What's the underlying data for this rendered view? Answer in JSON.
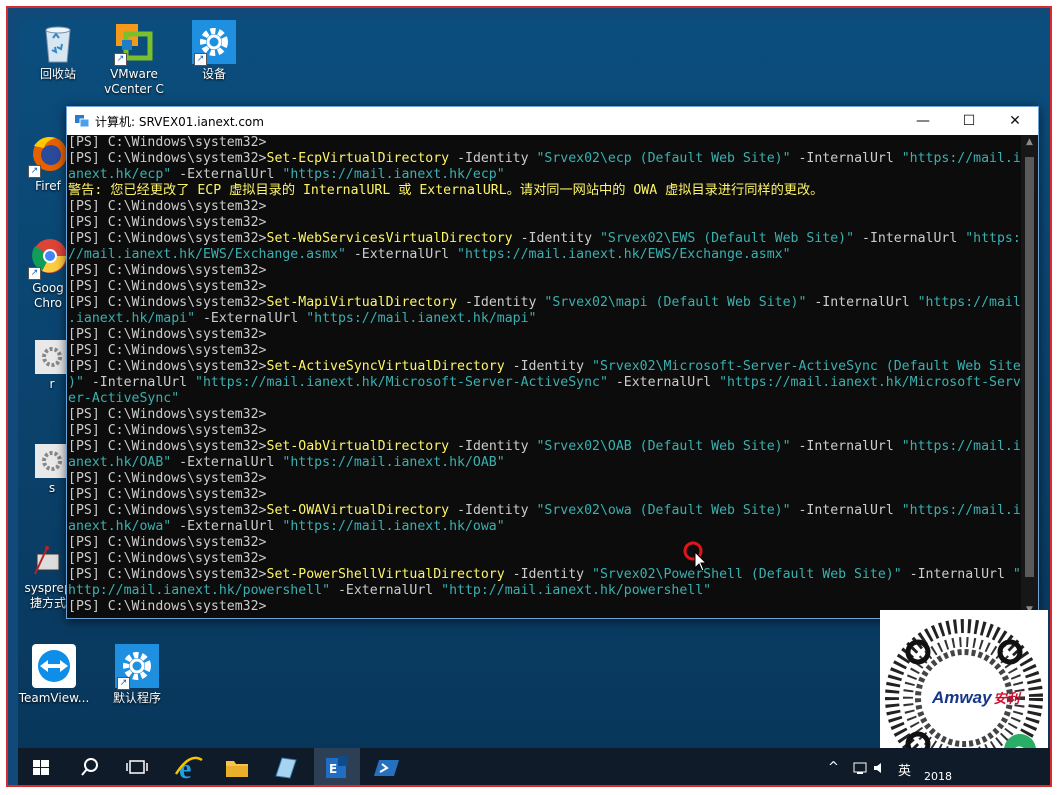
{
  "desktop": {
    "icons": [
      {
        "label": "回收站",
        "icon": "recycle-bin-icon"
      },
      {
        "label": "VMware\nvCenter C",
        "icon": "vmware-icon"
      },
      {
        "label": "设备",
        "icon": "gear-icon"
      },
      {
        "label": "Firef",
        "icon": "firefox-icon"
      },
      {
        "label": "Goog\nChro",
        "icon": "chrome-icon"
      },
      {
        "label": "r",
        "icon": "settings-shortcut-icon"
      },
      {
        "label": "s",
        "icon": "settings-shortcut-icon"
      },
      {
        "label": "sysprep\n捷方式",
        "icon": "sysprep-icon"
      },
      {
        "label": "TeamView...",
        "icon": "teamviewer-icon"
      },
      {
        "label": "默认程序",
        "icon": "gear-icon"
      }
    ]
  },
  "window": {
    "title": "计算机: SRVEX01.ianext.com",
    "minimize": "—",
    "maximize": "☐",
    "close": "✕"
  },
  "console": {
    "lines": [
      [
        {
          "t": "[PS] C:\\Windows\\system32>",
          "c": "par"
        }
      ],
      [
        {
          "t": "[PS] C:\\Windows\\system32>",
          "c": "par"
        },
        {
          "t": "Set-EcpVirtualDirectory",
          "c": "cmd"
        },
        {
          "t": " -Identity ",
          "c": "par"
        },
        {
          "t": "\"Srvex02\\ecp (Default Web Site)\"",
          "c": "str"
        },
        {
          "t": " -InternalUrl ",
          "c": "par"
        },
        {
          "t": "\"https://mail.i",
          "c": "str"
        }
      ],
      [
        {
          "t": "anext.hk/ecp\"",
          "c": "str"
        },
        {
          "t": " -ExternalUrl ",
          "c": "par"
        },
        {
          "t": "\"https://mail.ianext.hk/ecp\"",
          "c": "str"
        }
      ],
      [
        {
          "t": "警告: 您已经更改了 ECP 虚拟目录的 InternalURL 或 ExternalURL。请对同一网站中的 OWA 虚拟目录进行同样的更改。",
          "c": "warn"
        }
      ],
      [
        {
          "t": "[PS] C:\\Windows\\system32>",
          "c": "par"
        }
      ],
      [
        {
          "t": "[PS] C:\\Windows\\system32>",
          "c": "par"
        }
      ],
      [
        {
          "t": "[PS] C:\\Windows\\system32>",
          "c": "par"
        },
        {
          "t": "Set-WebServicesVirtualDirectory",
          "c": "cmd"
        },
        {
          "t": " -Identity ",
          "c": "par"
        },
        {
          "t": "\"Srvex02\\EWS (Default Web Site)\"",
          "c": "str"
        },
        {
          "t": " -InternalUrl ",
          "c": "par"
        },
        {
          "t": "\"https:",
          "c": "str"
        }
      ],
      [
        {
          "t": "//mail.ianext.hk/EWS/Exchange.asmx\"",
          "c": "str"
        },
        {
          "t": " -ExternalUrl ",
          "c": "par"
        },
        {
          "t": "\"https://mail.ianext.hk/EWS/Exchange.asmx\"",
          "c": "str"
        }
      ],
      [
        {
          "t": "[PS] C:\\Windows\\system32>",
          "c": "par"
        }
      ],
      [
        {
          "t": "[PS] C:\\Windows\\system32>",
          "c": "par"
        }
      ],
      [
        {
          "t": "[PS] C:\\Windows\\system32>",
          "c": "par"
        },
        {
          "t": "Set-MapiVirtualDirectory",
          "c": "cmd"
        },
        {
          "t": " -Identity ",
          "c": "par"
        },
        {
          "t": "\"Srvex02\\mapi (Default Web Site)\"",
          "c": "str"
        },
        {
          "t": " -InternalUrl ",
          "c": "par"
        },
        {
          "t": "\"https://mail",
          "c": "str"
        }
      ],
      [
        {
          "t": ".ianext.hk/mapi\"",
          "c": "str"
        },
        {
          "t": " -ExternalUrl ",
          "c": "par"
        },
        {
          "t": "\"https://mail.ianext.hk/mapi\"",
          "c": "str"
        }
      ],
      [
        {
          "t": "[PS] C:\\Windows\\system32>",
          "c": "par"
        }
      ],
      [
        {
          "t": "[PS] C:\\Windows\\system32>",
          "c": "par"
        }
      ],
      [
        {
          "t": "[PS] C:\\Windows\\system32>",
          "c": "par"
        },
        {
          "t": "Set-ActiveSyncVirtualDirectory",
          "c": "cmd"
        },
        {
          "t": " -Identity ",
          "c": "par"
        },
        {
          "t": "\"Srvex02\\Microsoft-Server-ActiveSync (Default Web Site",
          "c": "str"
        }
      ],
      [
        {
          "t": ")\"",
          "c": "str"
        },
        {
          "t": " -InternalUrl ",
          "c": "par"
        },
        {
          "t": "\"https://mail.ianext.hk/Microsoft-Server-ActiveSync\"",
          "c": "str"
        },
        {
          "t": " -ExternalUrl ",
          "c": "par"
        },
        {
          "t": "\"https://mail.ianext.hk/Microsoft-Serv",
          "c": "str"
        }
      ],
      [
        {
          "t": "er-ActiveSync\"",
          "c": "str"
        }
      ],
      [
        {
          "t": "[PS] C:\\Windows\\system32>",
          "c": "par"
        }
      ],
      [
        {
          "t": "[PS] C:\\Windows\\system32>",
          "c": "par"
        }
      ],
      [
        {
          "t": "[PS] C:\\Windows\\system32>",
          "c": "par"
        },
        {
          "t": "Set-OabVirtualDirectory",
          "c": "cmd"
        },
        {
          "t": " -Identity ",
          "c": "par"
        },
        {
          "t": "\"Srvex02\\OAB (Default Web Site)\"",
          "c": "str"
        },
        {
          "t": " -InternalUrl ",
          "c": "par"
        },
        {
          "t": "\"https://mail.i",
          "c": "str"
        }
      ],
      [
        {
          "t": "anext.hk/OAB\"",
          "c": "str"
        },
        {
          "t": " -ExternalUrl ",
          "c": "par"
        },
        {
          "t": "\"https://mail.ianext.hk/OAB\"",
          "c": "str"
        }
      ],
      [
        {
          "t": "[PS] C:\\Windows\\system32>",
          "c": "par"
        }
      ],
      [
        {
          "t": "[PS] C:\\Windows\\system32>",
          "c": "par"
        }
      ],
      [
        {
          "t": "[PS] C:\\Windows\\system32>",
          "c": "par"
        },
        {
          "t": "Set-OWAVirtualDirectory",
          "c": "cmd"
        },
        {
          "t": " -Identity ",
          "c": "par"
        },
        {
          "t": "\"Srvex02\\owa (Default Web Site)\"",
          "c": "str"
        },
        {
          "t": " -InternalUrl ",
          "c": "par"
        },
        {
          "t": "\"https://mail.i",
          "c": "str"
        }
      ],
      [
        {
          "t": "anext.hk/owa\"",
          "c": "str"
        },
        {
          "t": " -ExternalUrl ",
          "c": "par"
        },
        {
          "t": "\"https://mail.ianext.hk/owa\"",
          "c": "str"
        }
      ],
      [
        {
          "t": "[PS] C:\\Windows\\system32>",
          "c": "par"
        }
      ],
      [
        {
          "t": "[PS] C:\\Windows\\system32>",
          "c": "par"
        }
      ],
      [
        {
          "t": "[PS] C:\\Windows\\system32>",
          "c": "par"
        },
        {
          "t": "Set-PowerShellVirtualDirectory",
          "c": "cmd"
        },
        {
          "t": " -Identity ",
          "c": "par"
        },
        {
          "t": "\"Srvex02\\PowerShell (Default Web Site)\"",
          "c": "str"
        },
        {
          "t": " -InternalUrl ",
          "c": "par"
        },
        {
          "t": "\"",
          "c": "str"
        }
      ],
      [
        {
          "t": "http://mail.ianext.hk/powershell\"",
          "c": "str"
        },
        {
          "t": " -ExternalUrl ",
          "c": "par"
        },
        {
          "t": "\"http://mail.ianext.hk/powershell\"",
          "c": "str"
        }
      ],
      [
        {
          "t": "[PS] C:\\Windows\\system32>",
          "c": "par"
        }
      ]
    ]
  },
  "taskbar": {
    "items": [
      "start-icon",
      "search-icon",
      "task-view-icon",
      "ie-icon",
      "file-explorer-icon",
      "server-manager-icon",
      "exchange-shell-icon",
      "powershell-icon"
    ],
    "tray_lang": "英",
    "clock": "2018"
  },
  "qr": {
    "brand": "Amway",
    "brand_cn": "安利"
  },
  "colors": {
    "frame_border": "#d92b2b",
    "console_bg": "#0c0c0c",
    "cmd": "#fdf567",
    "string": "#3ab0b0",
    "text": "#cccccc"
  }
}
